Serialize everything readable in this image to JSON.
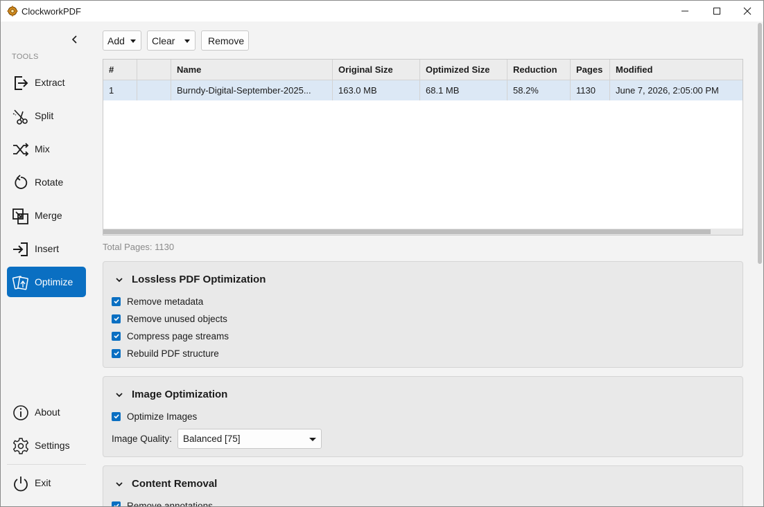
{
  "window": {
    "title": "ClockworkPDF"
  },
  "sidebar": {
    "section_label": "TOOLS",
    "items": [
      {
        "label": "Extract",
        "icon": "extract-icon"
      },
      {
        "label": "Split",
        "icon": "scissors-icon"
      },
      {
        "label": "Mix",
        "icon": "shuffle-icon"
      },
      {
        "label": "Rotate",
        "icon": "rotate-icon"
      },
      {
        "label": "Merge",
        "icon": "merge-icon"
      },
      {
        "label": "Insert",
        "icon": "insert-icon"
      },
      {
        "label": "Optimize",
        "icon": "optimize-icon",
        "active": true
      }
    ],
    "bottom_items": [
      {
        "label": "About",
        "icon": "info-icon"
      },
      {
        "label": "Settings",
        "icon": "gear-icon"
      },
      {
        "label": "Exit",
        "icon": "power-icon"
      }
    ]
  },
  "toolbar": {
    "add_label": "Add",
    "clear_label": "Clear",
    "remove_label": "Remove"
  },
  "table": {
    "columns": [
      "#",
      "",
      "Name",
      "Original Size",
      "Optimized Size",
      "Reduction",
      "Pages",
      "Modified"
    ],
    "rows": [
      {
        "index": "1",
        "thumb": "",
        "name": "Burndy-Digital-September-2025...",
        "original_size": "163.0 MB",
        "optimized_size": "68.1 MB",
        "reduction": "58.2%",
        "pages": "1130",
        "modified": "June 7, 2026, 2:05:00 PM"
      }
    ]
  },
  "total_pages": "Total Pages: 1130",
  "lossless": {
    "title": "Lossless PDF Optimization",
    "options": [
      "Remove metadata",
      "Remove unused objects",
      "Compress page streams",
      "Rebuild PDF structure"
    ]
  },
  "image_opt": {
    "title": "Image Optimization",
    "optimize_images_label": "Optimize Images",
    "quality_label": "Image Quality:",
    "quality_value": "Balanced [75]"
  },
  "content_removal": {
    "title": "Content Removal",
    "first_option": "Remove annotations"
  },
  "colors": {
    "accent": "#0a6fc2",
    "selected_row": "#dce8f5"
  }
}
